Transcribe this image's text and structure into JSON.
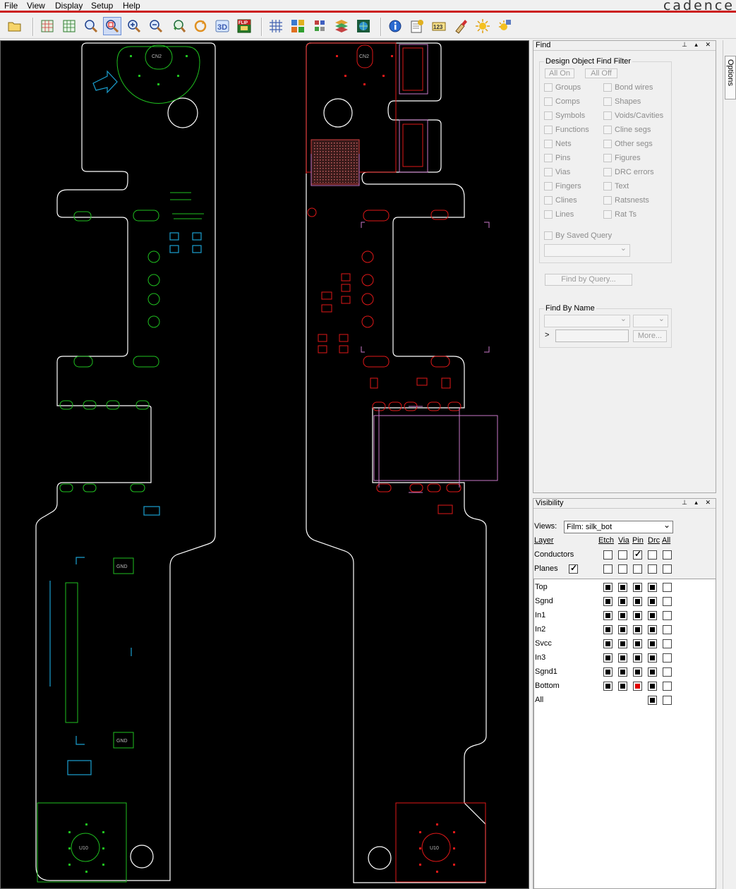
{
  "menu": {
    "file": "File",
    "view": "View",
    "display": "Display",
    "setup": "Setup",
    "help": "Help",
    "brand": "cadence"
  },
  "toolbar": {
    "icons": [
      "open-folder-icon",
      "grid-board-icon",
      "grid-board2-icon",
      "zoom-fit-icon",
      "zoom-window-icon",
      "zoom-in-icon",
      "zoom-out-icon",
      "zoom-previous-icon",
      "redraw-icon",
      "3d-view-icon",
      "flip-board-icon",
      "grid-icon",
      "color-icon",
      "layer-icon",
      "shadow-icon",
      "network-icon",
      "info-icon",
      "report-icon",
      "measure-icon",
      "highlight-icon",
      "sun-icon",
      "dehighlight-icon"
    ],
    "label_3d": "3D",
    "label_flip": "FLIP",
    "label_measure": "123"
  },
  "options_tab": "Options",
  "find": {
    "title": "Find",
    "filter_title": "Design Object Find Filter",
    "all_on": "All On",
    "all_off": "All Off",
    "left_items": [
      "Groups",
      "Comps",
      "Symbols",
      "Functions",
      "Nets",
      "Pins",
      "Vias",
      "Fingers",
      "Clines",
      "Lines"
    ],
    "right_items": [
      "Bond wires",
      "Shapes",
      "Voids/Cavities",
      "Cline segs",
      "Other segs",
      "Figures",
      "DRC errors",
      "Text",
      "Ratsnests",
      "Rat Ts"
    ],
    "saved_query": "By Saved Query",
    "find_by_query": "Find by Query...",
    "find_by_name_title": "Find By Name",
    "more": "More...",
    "name_prompt": ">"
  },
  "visibility": {
    "title": "Visibility",
    "views_label": "Views:",
    "views_value": "Film: silk_bot",
    "layer_header": "Layer",
    "columns": [
      "Etch",
      "Via",
      "Pin",
      "Drc",
      "All"
    ],
    "conductors": "Conductors",
    "planes": "Planes",
    "layers": [
      "Top",
      "Sgnd",
      "In1",
      "In2",
      "Svcc",
      "In3",
      "Sgnd1",
      "Bottom",
      "All"
    ]
  },
  "board": {
    "silk_labels": [
      "CN2",
      "CN2",
      "GND",
      "GND",
      "U10",
      "U10"
    ]
  },
  "colors": {
    "canvas": "#000000",
    "outline": "#ffffff",
    "silk_top": "#1fbf1f",
    "silk_bottom": "#e01818",
    "package": "#c878c8",
    "accent": "#cc1f1f"
  }
}
